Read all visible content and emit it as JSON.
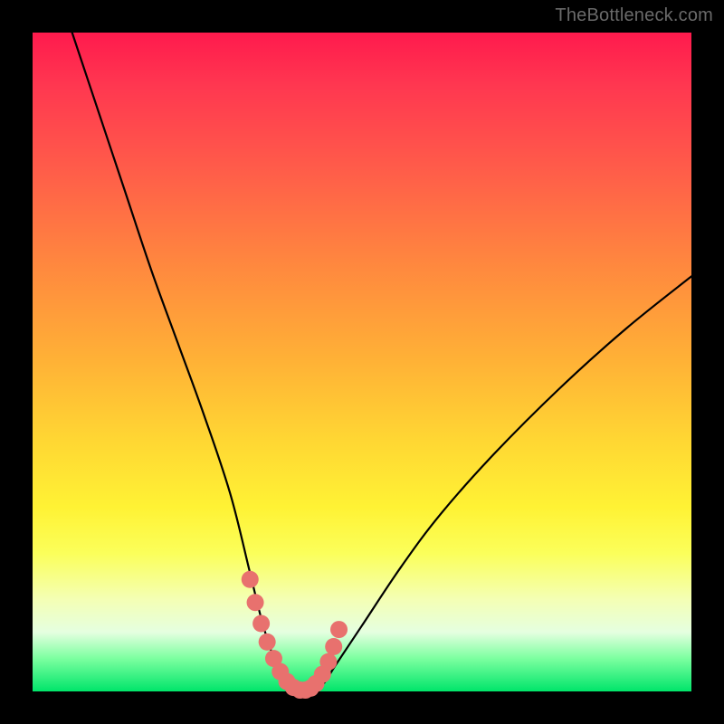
{
  "watermark": "TheBottleneck.com",
  "colors": {
    "frame_bg": "#000000",
    "gradient_top": "#ff1a4d",
    "gradient_bottom": "#00e56a",
    "curve_stroke": "#000000",
    "marker_fill": "#e8716e",
    "marker_stroke": "#e8716e"
  },
  "chart_data": {
    "type": "line",
    "title": "",
    "xlabel": "",
    "ylabel": "",
    "xlim": [
      0,
      100
    ],
    "ylim": [
      0,
      100
    ],
    "note": "Bottleneck-style V-curve; y ≈ percentage bottleneck (0 at valley). Values estimated from pixel positions.",
    "series": [
      {
        "name": "bottleneck-curve",
        "x": [
          6,
          10,
          14,
          18,
          22,
          26,
          30,
          33,
          35,
          37,
          38.5,
          40,
          42,
          44,
          46,
          50,
          56,
          62,
          70,
          80,
          90,
          100
        ],
        "y": [
          100,
          88,
          76,
          64,
          53,
          42,
          30,
          18,
          10,
          4,
          1,
          0,
          0,
          1,
          4,
          10,
          19,
          27,
          36,
          46,
          55,
          63
        ]
      }
    ],
    "markers": {
      "name": "highlight-dots",
      "x": [
        33.0,
        33.8,
        34.7,
        35.6,
        36.6,
        37.6,
        38.6,
        39.6,
        40.6,
        41.4,
        42.2,
        43.0,
        44.0,
        44.9,
        45.7,
        46.5
      ],
      "y": [
        17.0,
        13.5,
        10.3,
        7.5,
        5.0,
        3.0,
        1.5,
        0.6,
        0.2,
        0.2,
        0.5,
        1.2,
        2.6,
        4.5,
        6.8,
        9.4
      ]
    }
  }
}
